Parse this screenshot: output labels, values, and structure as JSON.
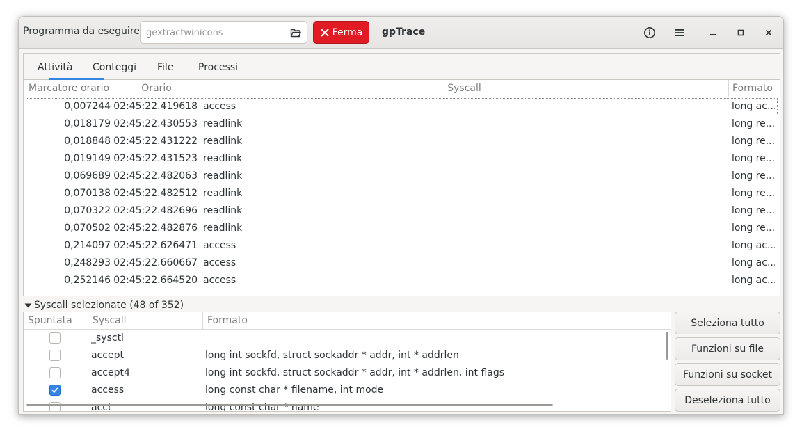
{
  "header": {
    "program_label": "Programma da eseguire:",
    "program_placeholder": "gextractwinicons",
    "stop_label": "Ferma",
    "app_title": "gpTrace",
    "icons": [
      "folder-open-icon",
      "stop-x-icon",
      "info-icon",
      "menu-icon",
      "minimize-icon",
      "maximize-icon",
      "close-icon"
    ]
  },
  "tabs": [
    {
      "label": "Attività",
      "active": true
    },
    {
      "label": "Conteggi",
      "active": false
    },
    {
      "label": "File",
      "active": false
    },
    {
      "label": "Processi",
      "active": false
    }
  ],
  "activity": {
    "columns": [
      "Marcatore orario",
      "Orario",
      "Syscall",
      "Formato"
    ],
    "rows": [
      {
        "marker": "0,007244",
        "time": "02:45:22.419618",
        "syscall": "access",
        "format": "long ac..."
      },
      {
        "marker": "0,018179",
        "time": "02:45:22.430553",
        "syscall": "readlink",
        "format": "long re..."
      },
      {
        "marker": "0,018848",
        "time": "02:45:22.431222",
        "syscall": "readlink",
        "format": "long re..."
      },
      {
        "marker": "0,019149",
        "time": "02:45:22.431523",
        "syscall": "readlink",
        "format": "long re..."
      },
      {
        "marker": "0,069689",
        "time": "02:45:22.482063",
        "syscall": "readlink",
        "format": "long re..."
      },
      {
        "marker": "0,070138",
        "time": "02:45:22.482512",
        "syscall": "readlink",
        "format": "long re..."
      },
      {
        "marker": "0,070322",
        "time": "02:45:22.482696",
        "syscall": "readlink",
        "format": "long re..."
      },
      {
        "marker": "0,070502",
        "time": "02:45:22.482876",
        "syscall": "readlink",
        "format": "long re..."
      },
      {
        "marker": "0,214097",
        "time": "02:45:22.626471",
        "syscall": "access",
        "format": "long ac..."
      },
      {
        "marker": "0,248293",
        "time": "02:45:22.660667",
        "syscall": "access",
        "format": "long ac..."
      },
      {
        "marker": "0,252146",
        "time": "02:45:22.664520",
        "syscall": "access",
        "format": "long ac..."
      }
    ]
  },
  "selected": {
    "expander_label": "Syscall selezionate (48 of 352)",
    "columns": [
      "Spuntata",
      "Syscall",
      "Formato"
    ],
    "rows": [
      {
        "checked": false,
        "syscall": "_sysctl",
        "format": ""
      },
      {
        "checked": false,
        "syscall": "accept",
        "format": "long int sockfd, struct sockaddr * addr, int * addrlen"
      },
      {
        "checked": false,
        "syscall": "accept4",
        "format": "long int sockfd, struct sockaddr * addr, int * addrlen, int flags"
      },
      {
        "checked": true,
        "syscall": "access",
        "format": "long const char * filename, int mode"
      },
      {
        "checked": false,
        "syscall": "acct",
        "format": "long const char * name"
      }
    ]
  },
  "buttons": {
    "select_all": "Seleziona tutto",
    "file_functions": "Funzioni su file",
    "socket_functions": "Funzioni su socket",
    "deselect_all": "Deseleziona tutto"
  },
  "colors": {
    "accent": "#3584e4",
    "stop": "#e01b24"
  }
}
